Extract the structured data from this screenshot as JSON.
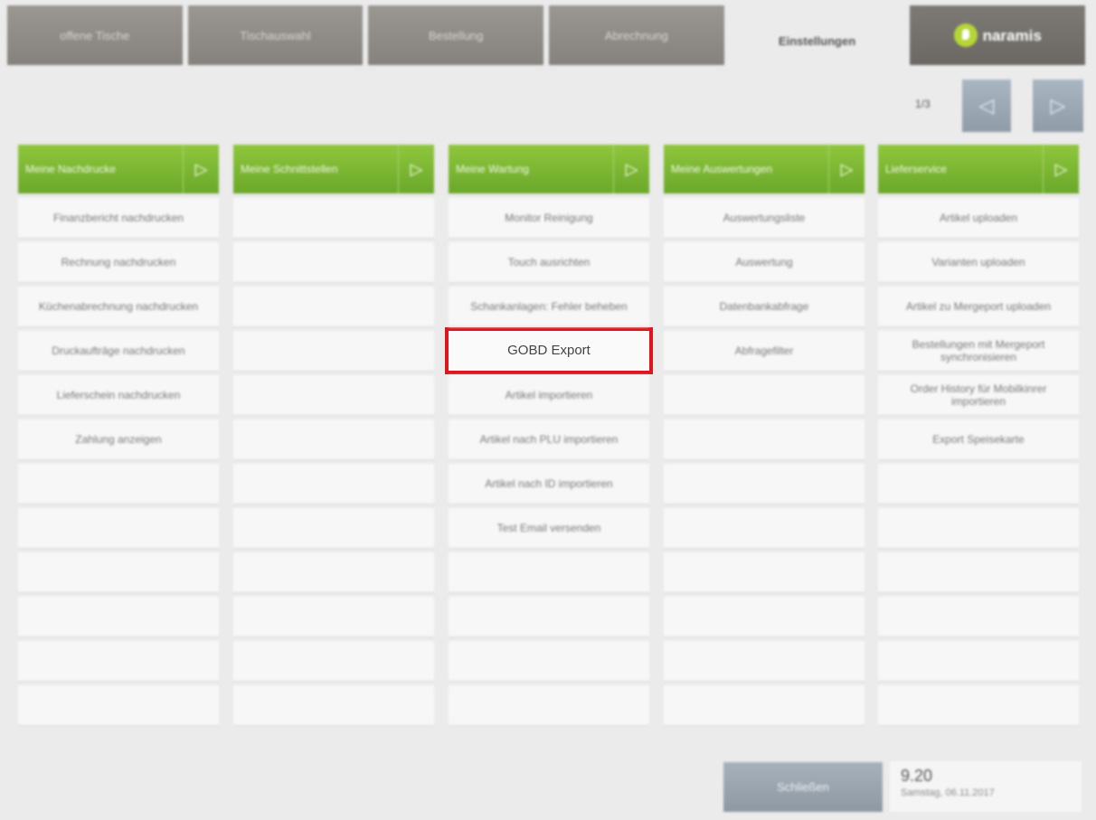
{
  "tabs": [
    {
      "label": "offene Tische"
    },
    {
      "label": "Tischauswahl"
    },
    {
      "label": "Bestellung"
    },
    {
      "label": "Abrechnung"
    },
    {
      "label": "Einstellungen",
      "active": true
    },
    {
      "label": "naramis",
      "brand": true
    }
  ],
  "pager": {
    "label": "1/3",
    "prev_icon": "triangle-left-icon",
    "next_icon": "triangle-right-icon"
  },
  "columns": [
    {
      "header": "Meine Nachdrucke",
      "items": [
        "Finanzbericht nachdrucken",
        "Rechnung nachdrucken",
        "Küchenabrechnung nachdrucken",
        "Druckaufträge nachdrucken",
        "Lieferschein nachdrucken",
        "Zahlung anzeigen",
        "",
        "",
        "",
        "",
        "",
        ""
      ]
    },
    {
      "header": "Meine Schnittstellen",
      "items": [
        "",
        "",
        "",
        "",
        "",
        "",
        "",
        "",
        "",
        "",
        "",
        ""
      ]
    },
    {
      "header": "Meine Wartung",
      "items": [
        "Monitor Reinigung",
        "Touch ausrichten",
        "Schankanlagen: Fehler beheben",
        "GOBD Export",
        "Artikel importieren",
        "Artikel nach PLU importieren",
        "Artikel nach ID importieren",
        "Test Email versenden",
        "",
        "",
        "",
        ""
      ]
    },
    {
      "header": "Meine Auswertungen",
      "items": [
        "Auswertungsliste",
        "Auswertung",
        "Datenbankabfrage",
        "Abfragefilter",
        "",
        "",
        "",
        "",
        "",
        "",
        "",
        ""
      ]
    },
    {
      "header": "Lieferservice",
      "items": [
        "Artikel uploaden",
        "Varianten uploaden",
        "Artikel zu Mergeport uploaden",
        "Bestellungen mit Mergeport synchronisieren",
        "Order History für Mobilkinrer importieren",
        "Export Speisekarte",
        "",
        "",
        "",
        "",
        "",
        ""
      ]
    }
  ],
  "highlighted_item": "GOBD Export",
  "footer": {
    "button_label": "Schließen",
    "version": "9.20",
    "date": "Samstag, 06.11.2017"
  },
  "colors": {
    "header_green": "#7ab432",
    "highlight_red": "#e0141b",
    "tab_gray": "#8e8a86"
  }
}
